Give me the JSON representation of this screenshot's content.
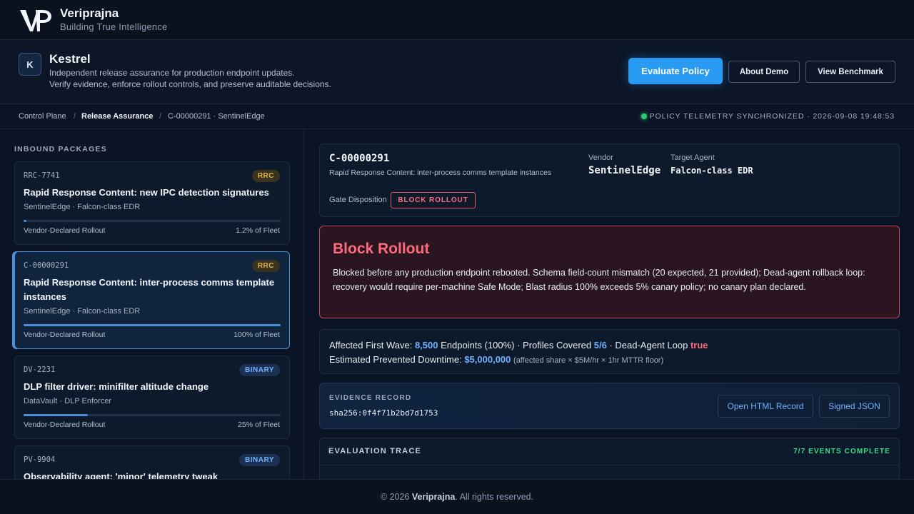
{
  "brand": {
    "name": "Veriprajna",
    "tagline": "Building True Intelligence"
  },
  "product": {
    "badge": "K",
    "name": "Kestrel",
    "desc_line1": "Independent release assurance for production endpoint updates.",
    "desc_line2": "Verify evidence, enforce rollout controls, and preserve auditable decisions.",
    "btn_evaluate": "Evaluate Policy",
    "btn_about": "About Demo",
    "btn_benchmark": "View Benchmark"
  },
  "breadcrumb": {
    "items": [
      "Control Plane",
      "Release Assurance",
      "C-00000291 · SentinelEdge"
    ],
    "sep": "/",
    "sync_status": "POLICY TELEMETRY SYNCHRONIZED · 2026-09-08 19:48:53"
  },
  "colors": {
    "accent": "#2a9bf2",
    "danger": "#ff6b7d",
    "success": "#3ddc84",
    "tag_rrc": "#e6b54a",
    "tag_binary": "#6fb1ff"
  },
  "inbound": {
    "label": "INBOUND PACKAGES",
    "packages": [
      {
        "id": "RRC-7741",
        "tag": "RRC",
        "title": "Rapid Response Content: new IPC detection signatures",
        "vendor": "SentinelEdge · Falcon-class EDR",
        "rollout_label": "Vendor-Declared Rollout",
        "rollout_pct": "1.2% of Fleet",
        "rollout_fraction": 0.012
      },
      {
        "id": "C-00000291",
        "tag": "RRC",
        "title": "Rapid Response Content: inter-process comms template instances",
        "vendor": "SentinelEdge · Falcon-class EDR",
        "rollout_label": "Vendor-Declared Rollout",
        "rollout_pct": "100% of Fleet",
        "rollout_fraction": 1.0,
        "selected": true
      },
      {
        "id": "DV-2231",
        "tag": "BINARY",
        "title": "DLP filter driver: minifilter altitude change",
        "vendor": "DataVault · DLP Enforcer",
        "rollout_label": "Vendor-Declared Rollout",
        "rollout_pct": "25% of Fleet",
        "rollout_fraction": 0.25
      },
      {
        "id": "PV-9904",
        "tag": "BINARY",
        "title": "Observability agent: 'minor' telemetry tweak"
      }
    ]
  },
  "detail": {
    "id": "C-00000291",
    "desc": "Rapid Response Content: inter-process comms template instances",
    "vendor_label": "Vendor",
    "vendor": "SentinelEdge",
    "target_label": "Target Agent",
    "target": "Falcon-class EDR",
    "gate_label": "Gate Disposition",
    "gate_value": "BLOCK ROLLOUT"
  },
  "alert": {
    "title": "Block Rollout",
    "body": "Blocked before any production endpoint rebooted. Schema field-count mismatch (20 expected, 21 provided); Dead-agent rollback loop: recovery would require per-machine Safe Mode; Blast radius 100% exceeds 5% canary policy; no canary plan declared."
  },
  "stats": {
    "wave_label": "Affected First Wave:",
    "wave_value": "8,500",
    "wave_suffix": "Endpoints (100%) · Profiles Covered",
    "profiles_value": "5/6",
    "loop_label": "· Dead-Agent Loop",
    "loop_value": "true",
    "downtime_label": "Estimated Prevented Downtime:",
    "downtime_value": "$5,000,000",
    "downtime_note": "(affected share × $5M/hr × 1hr MTTR floor)"
  },
  "evidence": {
    "label": "EVIDENCE RECORD",
    "hash": "sha256:0f4f71b2bd7d1753",
    "btn_html": "Open HTML Record",
    "btn_json": "Signed JSON"
  },
  "trace": {
    "label": "EVALUATION TRACE",
    "status": "7/7 EVENTS COMPLETE"
  },
  "footer": {
    "prefix": "© 2026",
    "brand": "Veriprajna",
    "suffix": ". All rights reserved."
  }
}
